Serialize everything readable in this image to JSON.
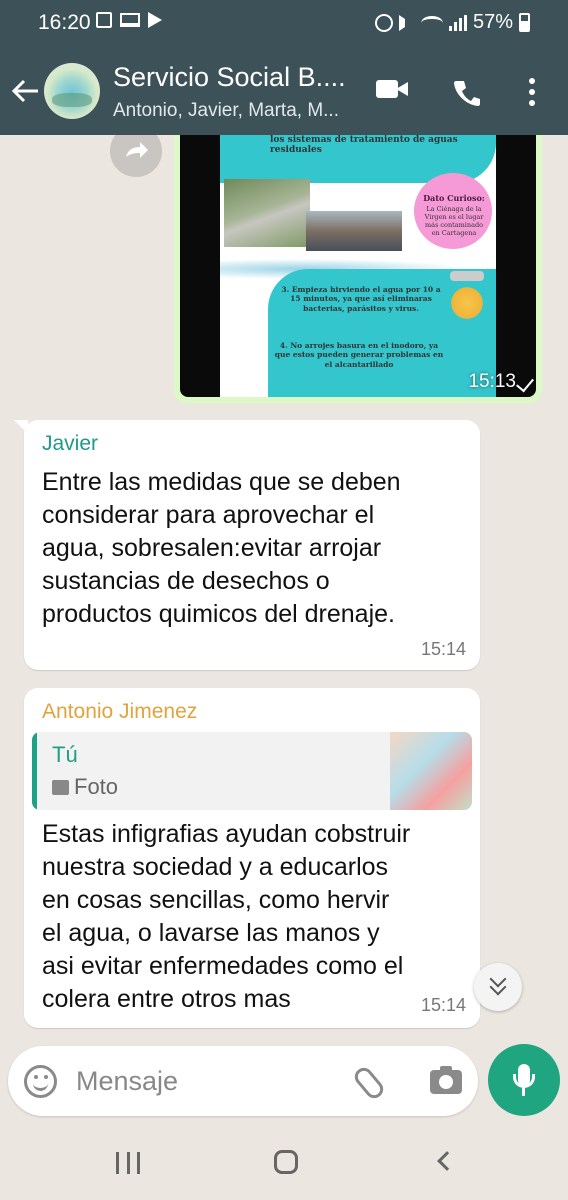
{
  "status_bar": {
    "time": "16:20",
    "battery": "57%"
  },
  "header": {
    "group_name": "Servicio Social B....",
    "participants": "Antonio, Javier, Marta, M..."
  },
  "image_message": {
    "time": "15:13",
    "infographic": {
      "top_text": "los sistemas de tratamiento de aguas residuales",
      "dato_title": "Dato Curioso:",
      "dato_text": "La Ciénaga de la Virgen es el lugar más contaminado en Cartagena",
      "step3": "3. Empieza hirviendo el agua por 10 a 15 minutos, ya que así eliminaras bacterias, parásitos y virus.",
      "step4": "4. No arrojes basura en el inodoro, ya que estos pueden generar problemas en el alcantarillado"
    }
  },
  "messages": [
    {
      "sender": "Javier",
      "text": "Entre las medidas que se deben\nconsiderar para aprovechar el\nagua, sobresalen:evitar arrojar\nsustancias de desechos o\nproductos quimicos del drenaje.",
      "time": "15:14"
    },
    {
      "sender": "Antonio Jimenez",
      "quote_author": "Tú",
      "quote_type": "Foto",
      "text": "Estas infigrafias ayudan cobstruir\nnuestra sociedad y a educarlos\nen cosas sencillas, como hervir\nel agua, o lavarse las manos y\nasi evitar enfermedades como el\ncolera entre otros mas",
      "time": "15:14"
    }
  ],
  "input": {
    "placeholder": "Mensaje"
  },
  "colors": {
    "header": "#3c5258",
    "chat_background": "#ebe6df",
    "accent_green": "#1fa57f",
    "sender_javier": "#1f9a8b",
    "sender_antonio": "#e0a43e"
  }
}
